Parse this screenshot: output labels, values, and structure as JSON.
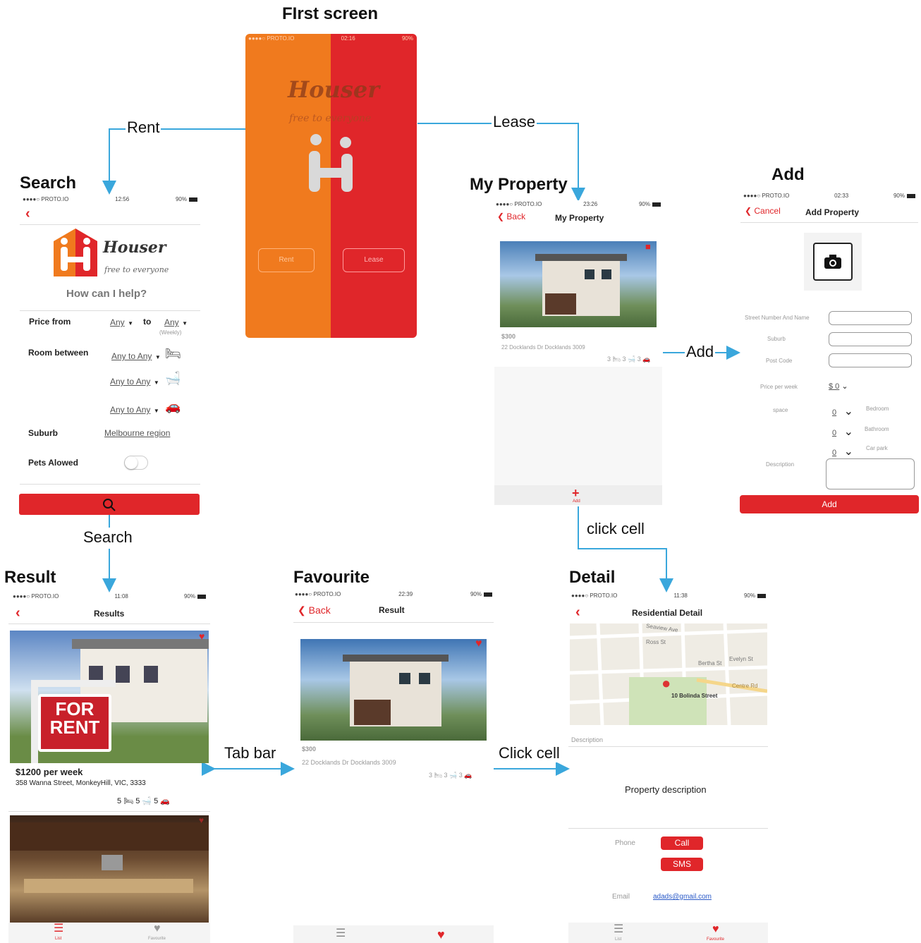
{
  "titles": {
    "first": "FIrst screen",
    "search": "Search",
    "my_property": "My Property",
    "add": "Add",
    "result": "Result",
    "favourite": "Favourite",
    "detail": "Detail"
  },
  "flow_labels": {
    "rent": "Rent",
    "lease": "Lease",
    "add": "Add",
    "search": "Search",
    "click_cell_1": "click cell",
    "tab_bar": "Tab bar",
    "click_cell_2": "Click cell"
  },
  "status": {
    "carrier": "●●●●○ PROTO.IO",
    "battery": "90%",
    "time_first": "02:16",
    "time_search": "12:56",
    "time_myprop": "23:26",
    "time_add": "02:33",
    "time_result": "11:08",
    "time_fav": "22:39",
    "time_detail": "11:38"
  },
  "first_screen": {
    "brand": "Houser",
    "tagline": "free to everyone",
    "rent_btn": "Rent",
    "lease_btn": "Lease",
    "colors": {
      "left": "#f07a1e",
      "right": "#e0262a"
    }
  },
  "search_screen": {
    "brand": "Houser",
    "tagline": "free to everyone",
    "question": "How can I help?",
    "price_label": "Price  from",
    "price_from": "Any",
    "price_to_label": "to",
    "price_to": "Any",
    "weekly": "(Weekly)",
    "room_label": "Room  between",
    "room_bed": "Any to Any",
    "room_bath": "Any to Any",
    "room_car": "Any to Any",
    "suburb_label": "Suburb",
    "suburb_value": "Melbourne region",
    "pets_label": "Pets Alowed"
  },
  "myprop_screen": {
    "back": "Back",
    "title": "My Property",
    "price": "$300",
    "address": "22 Docklands Dr Docklands 3009",
    "bed": "3",
    "bath": "3",
    "car": "3",
    "add_label": "Add"
  },
  "add_screen": {
    "cancel": "Cancel",
    "title": "Add Property",
    "street_label": "Street Number And Name",
    "suburb_label": "Suburb",
    "postcode_label": "Post Code",
    "price_label": "Price per week",
    "price_value": "$ 0",
    "space_label": "space",
    "bedroom_value": "0",
    "bedroom_label": "Bedroom",
    "bathroom_value": "0",
    "bathroom_label": "Bathroom",
    "carpark_value": "0",
    "carpark_label": "Car park",
    "desc_label": "Description",
    "add_btn": "Add"
  },
  "result_screen": {
    "title": "Results",
    "sign_line1": "FOR",
    "sign_line2": "RENT",
    "price": "$1200 per week",
    "address": "358 Wanna Street, MonkeyHill, VIC, 3333",
    "bed": "5",
    "bath": "5",
    "car": "5",
    "tab_list": "List",
    "tab_fav": "Favourite"
  },
  "fav_screen": {
    "back": "Back",
    "title": "Result",
    "price": "$300",
    "address": "22 Docklands Dr Docklands 3009",
    "bed": "3",
    "bath": "3",
    "car": "3"
  },
  "detail_screen": {
    "title": "Residential Detail",
    "map_pin_label": "10 Bolinda Street",
    "streets": [
      "Seaview Ave",
      "Ross St",
      "Evelyn St",
      "Centre Rd",
      "Bertha St"
    ],
    "desc_label": "Description",
    "desc_text": "Property description",
    "phone_label": "Phone",
    "call_btn": "Call",
    "sms_btn": "SMS",
    "email_label": "Email",
    "email_value": "adads@gmail.com",
    "tab_list": "List",
    "tab_fav": "Favourite"
  }
}
